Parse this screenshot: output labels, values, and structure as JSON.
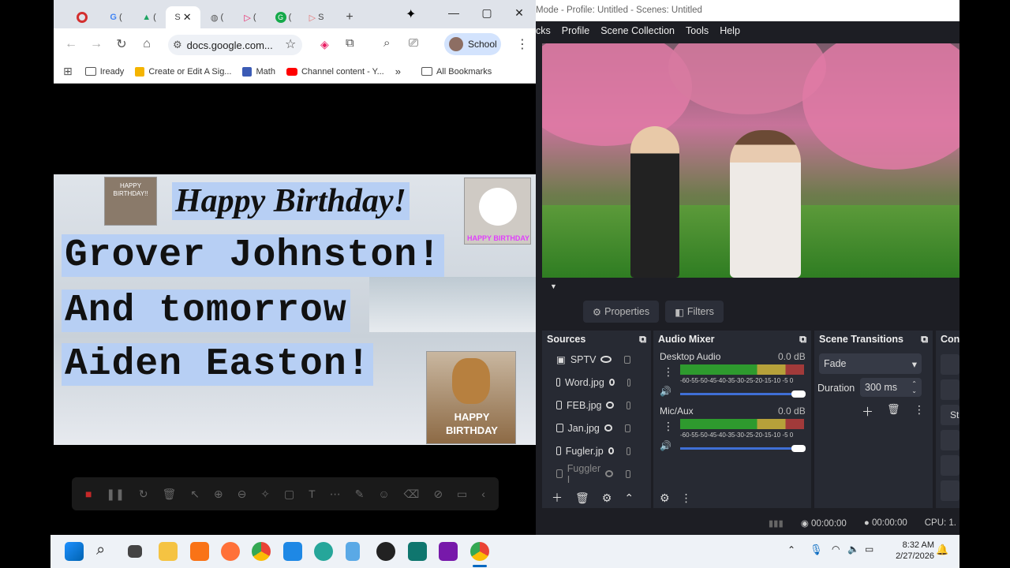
{
  "browser": {
    "window_controls": {
      "minimize": "—",
      "maximize": "▢",
      "close": "✕"
    },
    "tabs": [
      {
        "label": "",
        "color": "#d32f2f"
      },
      {
        "label": "(",
        "color": "#fff"
      },
      {
        "label": "(",
        "color": "#1fa463"
      },
      {
        "label": "S",
        "color": "#fff",
        "active": true
      },
      {
        "label": "(",
        "color": "#4285f4"
      },
      {
        "label": "(",
        "color": "#e91e63"
      },
      {
        "label": "(",
        "color": "#15a94a"
      },
      {
        "label": "S",
        "color": "#e57373"
      }
    ],
    "new_tab": "+",
    "address": "docs.google.com...",
    "profile_label": "School",
    "bookmarks": [
      {
        "label": "Iready",
        "icon": "folder"
      },
      {
        "label": "Create or Edit A Sig...",
        "icon": "bookmark"
      },
      {
        "label": "Math",
        "icon": "bookmark"
      },
      {
        "label": "Channel content - Y...",
        "icon": "youtube"
      }
    ],
    "bookmarks_more": "»",
    "all_bookmarks": "All Bookmarks"
  },
  "slide": {
    "title": "Happy Birthday!",
    "line1": "Grover Johnston!",
    "line2": "And tomorrow",
    "line3": "Aiden Easton!",
    "photo_top_left": "HAPPY BIRTHDAY!!",
    "photo_top_right": "HAPPY BIRTHDAY",
    "photo_bottom_right_1": "HAPPY",
    "photo_bottom_right_2": "BIRTHDAY"
  },
  "obs": {
    "title": "Mode - Profile: Untitled - Scenes: Untitled",
    "menu": [
      "cks",
      "Profile",
      "Scene Collection",
      "Tools",
      "Help"
    ],
    "properties": "Properties",
    "filters": "Filters",
    "sources_title": "Sources",
    "sources": [
      "SPTV",
      "Word.jpg",
      "FEB.jpg",
      "Jan.jpg",
      "Fugler.jp",
      "Fuggler I"
    ],
    "mixer_title": "Audio Mixer",
    "channels": [
      {
        "name": "Desktop Audio",
        "db": "0.0 dB",
        "level": 0.62
      },
      {
        "name": "Mic/Aux",
        "db": "0.0 dB",
        "level": 0.62
      }
    ],
    "meter_ticks": "-60-55-50-45-40-35-30-25-20-15-10 -5 0",
    "transitions_title": "Scene Transitions",
    "transition_value": "Fade",
    "duration_label": "Duration",
    "duration_value": "300 ms",
    "controls_title": "Cont",
    "controls_btn": "St",
    "time1": "00:00:00",
    "time2": "00:00:00",
    "cpu": "CPU: 1."
  },
  "taskbar": {
    "time": "8:32 AM",
    "date": "2/27/2026"
  }
}
